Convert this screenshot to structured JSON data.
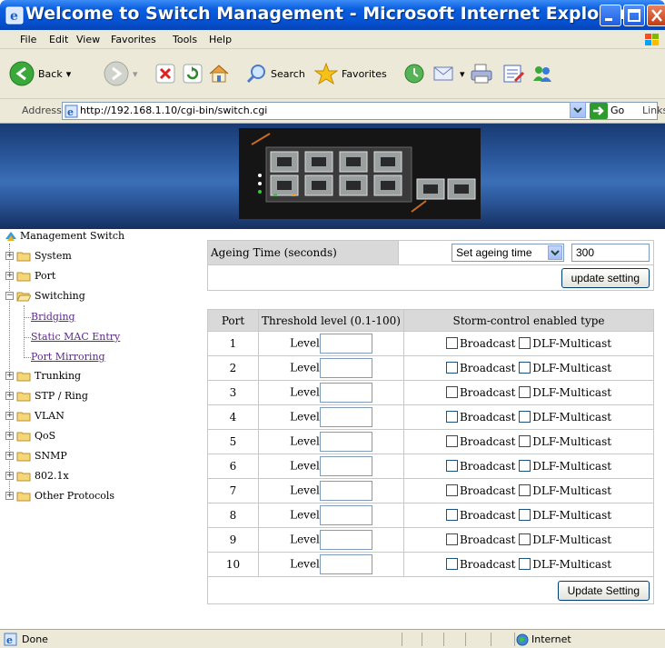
{
  "window": {
    "title": "Welcome to Switch Management - Microsoft Internet Explorer"
  },
  "menu": {
    "items": [
      "File",
      "Edit",
      "View",
      "Favorites",
      "Tools",
      "Help"
    ]
  },
  "toolbar": {
    "back_label": "Back",
    "search_label": "Search",
    "favorites_label": "Favorites"
  },
  "address": {
    "label": "Address",
    "url": "http://192.168.1.10/cgi-bin/switch.cgi",
    "go_label": "Go",
    "links_label": "Links"
  },
  "tree": {
    "root": "Management Switch",
    "nodes": [
      "System",
      "Port",
      "Switching",
      "Trunking",
      "STP / Ring",
      "VLAN",
      "QoS",
      "SNMP",
      "802.1x",
      "Other Protocols"
    ],
    "switching_children": [
      "Bridging",
      "Static MAC Entry",
      "Port Mirroring"
    ]
  },
  "ageing": {
    "label": "Ageing Time (seconds)",
    "select_value": "Set ageing time",
    "value": "300",
    "update_button": "update setting"
  },
  "storm": {
    "headers": [
      "Port",
      "Threshold level (0.1-100)",
      "Storm-control enabled type"
    ],
    "level_label": "Level",
    "broadcast_label": "Broadcast",
    "dlf_label": "DLF-Multicast",
    "ports": [
      "1",
      "2",
      "3",
      "4",
      "5",
      "6",
      "7",
      "8",
      "9",
      "10"
    ],
    "update_button": "Update Setting"
  },
  "status": {
    "text": "Done",
    "zone": "Internet"
  },
  "colors": {
    "title_bar": "#0553d4",
    "banner": "#2c5a9f",
    "header_bg": "#d9d9d9"
  }
}
